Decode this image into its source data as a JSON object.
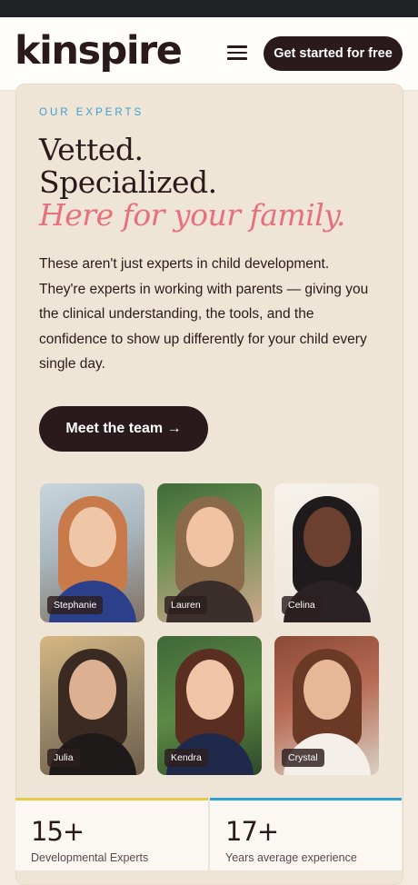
{
  "header": {
    "logo": "kinspire",
    "menu_icon": "hamburger-menu-icon",
    "cta_label": "Get started for free"
  },
  "section": {
    "eyebrow": "OUR EXPERTS",
    "headline_line1": "Vetted.",
    "headline_line2": "Specialized.",
    "headline_accent": "Here for your family.",
    "body": "These aren't just experts in child development. They're experts in working with parents — giving you the clinical understanding, the tools, and the confidence to show up differently for your child every single day.",
    "button_label": "Meet the team →"
  },
  "experts": [
    {
      "name": "Stephanie"
    },
    {
      "name": "Lauren"
    },
    {
      "name": "Celina"
    },
    {
      "name": "Julia"
    },
    {
      "name": "Kendra"
    },
    {
      "name": "Crystal"
    }
  ],
  "stats": [
    {
      "value": "15+",
      "label": "Developmental Experts",
      "accent": "#e9c94a"
    },
    {
      "value": "17+",
      "label": "Years average experience",
      "accent": "#2f9fd8"
    }
  ],
  "colors": {
    "brand_dark": "#2b1a1b",
    "accent_pink": "#e8707d",
    "eyebrow_blue": "#3aa0d4",
    "card_bg": "#efe5d6"
  }
}
